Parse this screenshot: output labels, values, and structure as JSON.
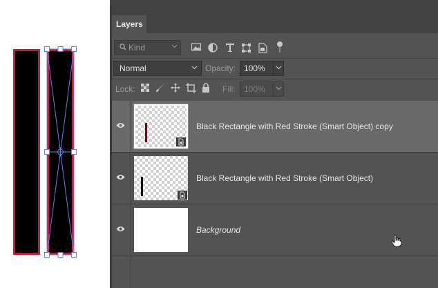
{
  "panel": {
    "tab_label": "Layers",
    "kind_filter": {
      "label": "Kind",
      "icons": [
        "image-filter-icon",
        "adjustment-filter-icon",
        "type-filter-icon",
        "shape-filter-icon",
        "smart-object-filter-icon",
        "filter-toggle-icon"
      ]
    },
    "blend_mode": "Normal",
    "opacity_label": "Opacity:",
    "opacity_value": "100%",
    "lock_label": "Lock:",
    "lock_icons": [
      "lock-transparent-pixels-icon",
      "lock-image-pixels-icon",
      "lock-position-icon",
      "lock-artboard-icon",
      "lock-all-icon"
    ],
    "fill_label": "Fill:",
    "fill_value": "100%"
  },
  "layers": [
    {
      "name": "Black Rectangle with Red Stroke (Smart Object) copy",
      "selected": true,
      "type": "smart-object"
    },
    {
      "name": "Black Rectangle with Red Stroke (Smart Object)",
      "selected": false,
      "type": "smart-object"
    },
    {
      "name": "Background",
      "selected": false,
      "type": "background"
    }
  ],
  "colors": {
    "rect_fill": "#000000",
    "rect_stroke": "#c41e3a",
    "transform_handle": "#6f7fe0",
    "panel_bg": "#535353",
    "selected_row": "#696969"
  }
}
